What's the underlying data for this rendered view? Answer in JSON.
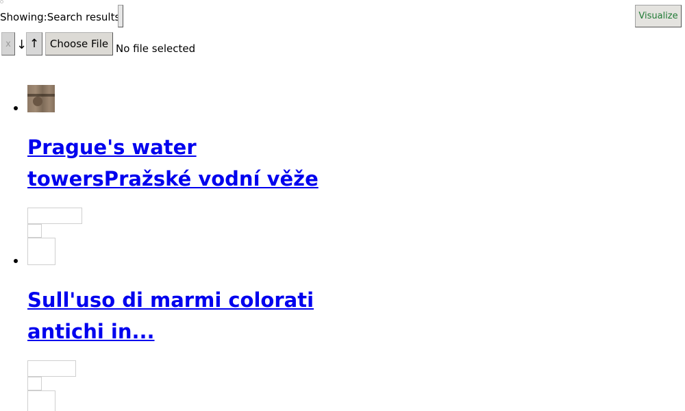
{
  "header": {
    "showing_prefix": "Showing:",
    "showing_value": "Search results",
    "visualize_label": "Visualize"
  },
  "toolbar": {
    "clear_label": "x",
    "sort_down_label": "↓",
    "sort_up_label": "↑",
    "choose_file_label": "Choose File",
    "file_status": "No file selected"
  },
  "results": [
    {
      "title": "Prague's water towersPražské vodní věže"
    },
    {
      "title": "Sull'uso di marmi colorati antichi in..."
    }
  ],
  "colors": {
    "link": "#0000ee",
    "visualize_text": "#1f7a34"
  }
}
